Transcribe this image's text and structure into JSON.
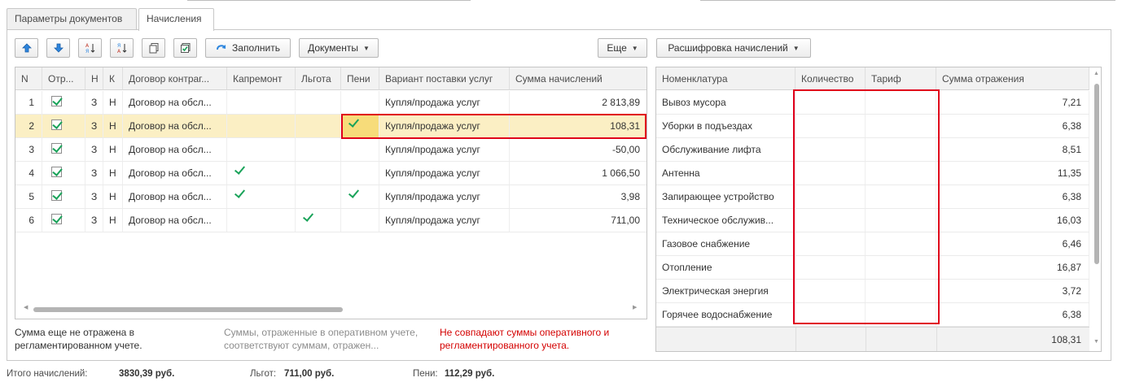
{
  "tabs": [
    {
      "label": "Параметры документов",
      "active": false
    },
    {
      "label": "Начисления",
      "active": true
    }
  ],
  "toolbar": {
    "fill_label": "Заполнить",
    "documents_label": "Документы",
    "more_label": "Еще",
    "decode_label": "Расшифровка начислений"
  },
  "left_table": {
    "headers": [
      "N",
      "Отр...",
      "Н",
      "К",
      "Договор контраг...",
      "Капремонт",
      "Льгота",
      "Пени",
      "Вариант поставки услуг",
      "Сумма начислений"
    ],
    "rows": [
      {
        "n": "1",
        "c3": "З",
        "c4": "Н",
        "contract": "Договор на обсл...",
        "kapremont": false,
        "lgota": false,
        "peni": false,
        "variant": "Купля/продажа услуг",
        "sum": "2 813,89",
        "selected": false
      },
      {
        "n": "2",
        "c3": "З",
        "c4": "Н",
        "contract": "Договор на обсл...",
        "kapremont": false,
        "lgota": false,
        "peni": true,
        "variant": "Купля/продажа услуг",
        "sum": "108,31",
        "selected": true
      },
      {
        "n": "3",
        "c3": "З",
        "c4": "Н",
        "contract": "Договор на обсл...",
        "kapremont": false,
        "lgota": false,
        "peni": false,
        "variant": "Купля/продажа услуг",
        "sum": "-50,00",
        "selected": false
      },
      {
        "n": "4",
        "c3": "З",
        "c4": "Н",
        "contract": "Договор на обсл...",
        "kapremont": true,
        "lgota": false,
        "peni": false,
        "variant": "Купля/продажа услуг",
        "sum": "1 066,50",
        "selected": false
      },
      {
        "n": "5",
        "c3": "З",
        "c4": "Н",
        "contract": "Договор на обсл...",
        "kapremont": true,
        "lgota": false,
        "peni": true,
        "variant": "Купля/продажа услуг",
        "sum": "3,98",
        "selected": false
      },
      {
        "n": "6",
        "c3": "З",
        "c4": "Н",
        "contract": "Договор на обсл...",
        "kapremont": false,
        "lgota": true,
        "peni": false,
        "variant": "Купля/продажа услуг",
        "sum": "711,00",
        "selected": false
      }
    ]
  },
  "right_table": {
    "headers": [
      "Номенклатура",
      "Количество",
      "Тариф",
      "Сумма отражения"
    ],
    "rows": [
      {
        "name": "Вывоз мусора",
        "sum": "7,21"
      },
      {
        "name": "Уборки в подъездах",
        "sum": "6,38"
      },
      {
        "name": "Обслуживание лифта",
        "sum": "8,51"
      },
      {
        "name": "Антенна",
        "sum": "11,35"
      },
      {
        "name": "Запирающее устройство",
        "sum": "6,38"
      },
      {
        "name": "Техническое обслужив...",
        "sum": "16,03"
      },
      {
        "name": "Газовое снабжение",
        "sum": "6,46"
      },
      {
        "name": "Отопление",
        "sum": "16,87"
      },
      {
        "name": "Электрическая энергия",
        "sum": "3,72"
      },
      {
        "name": "Горячее водоснабжение",
        "sum": "6,38"
      }
    ],
    "footer_total": "108,31"
  },
  "legend": {
    "not_reflected": "Сумма еще не отражена в регламентированном учете.",
    "match": "Суммы, отраженные в оперативном учете, соответствуют суммам, отражен...",
    "mismatch": "Не совпадают суммы оперативного и регламентированного учета."
  },
  "totals": {
    "charges_label": "Итого начислений:",
    "charges_value": "3830,39 руб.",
    "benefits_label": "Льгот:",
    "benefits_value": "711,00 руб.",
    "penalties_label": "Пени:",
    "penalties_value": "112,29 руб."
  },
  "colors": {
    "check_green": "#1aa35a",
    "selected_row": "#fbefc4",
    "highlight_red": "#e0001b",
    "mismatch_text": "#d40000",
    "match_text": "#8c8c8c"
  }
}
